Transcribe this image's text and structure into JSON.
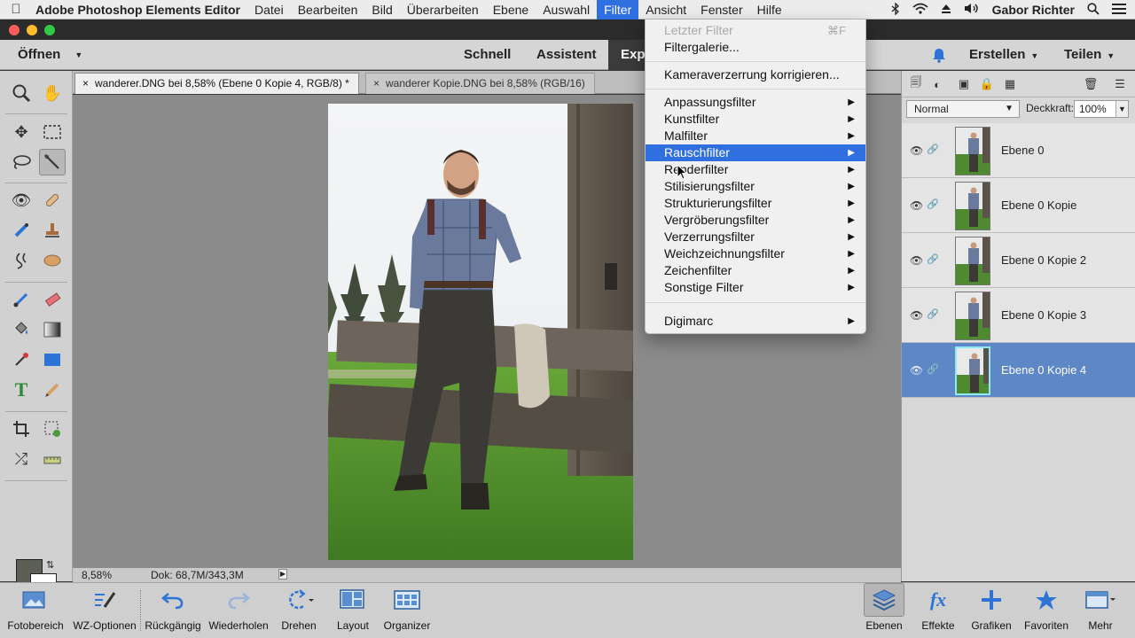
{
  "menubar": {
    "app_name": "Adobe Photoshop Elements Editor",
    "menus": [
      "Datei",
      "Bearbeiten",
      "Bild",
      "Überarbeiten",
      "Ebene",
      "Auswahl",
      "Filter",
      "Ansicht",
      "Fenster",
      "Hilfe"
    ],
    "active_menu": "Filter",
    "user": "Gabor Richter"
  },
  "modebar": {
    "open_label": "Öffnen",
    "tabs": [
      "Schnell",
      "Assistent",
      "Experte"
    ],
    "active_tab": "Experte",
    "create_label": "Erstellen",
    "share_label": "Teilen"
  },
  "doc_tabs": [
    {
      "title": "wanderer.DNG bei 8,58% (Ebene 0 Kopie 4, RGB/8) *",
      "active": true
    },
    {
      "title": "wanderer Kopie.DNG bei 8,58% (RGB/16)",
      "active": false
    }
  ],
  "status": {
    "zoom": "8,58%",
    "doc_info": "Dok: 68,7M/343,3M"
  },
  "layers_panel": {
    "blend_mode": "Normal",
    "opacity_label": "Deckkraft:",
    "opacity_value": "100%",
    "layers": [
      {
        "name": "Ebene 0",
        "selected": false
      },
      {
        "name": "Ebene 0 Kopie",
        "selected": false
      },
      {
        "name": "Ebene 0 Kopie 2",
        "selected": false
      },
      {
        "name": "Ebene 0 Kopie 3",
        "selected": false
      },
      {
        "name": "Ebene 0 Kopie 4",
        "selected": true
      }
    ]
  },
  "bottombar": {
    "items": [
      {
        "label": "Fotobereich",
        "icon": "photo-bin-icon"
      },
      {
        "label": "WZ-Optionen",
        "icon": "tool-options-icon"
      },
      {
        "label": "Rückgängig",
        "icon": "undo-icon"
      },
      {
        "label": "Wiederholen",
        "icon": "redo-icon"
      },
      {
        "label": "Drehen",
        "icon": "rotate-icon"
      },
      {
        "label": "Layout",
        "icon": "layout-icon"
      },
      {
        "label": "Organizer",
        "icon": "organizer-icon"
      },
      {
        "label": "Ebenen",
        "icon": "layers-icon"
      },
      {
        "label": "Effekte",
        "icon": "fx-icon"
      },
      {
        "label": "Grafiken",
        "icon": "plus-icon"
      },
      {
        "label": "Favoriten",
        "icon": "star-icon"
      },
      {
        "label": "Mehr",
        "icon": "more-icon"
      }
    ]
  },
  "filter_menu": {
    "items": [
      {
        "label": "Letzter Filter",
        "shortcut": "⌘F",
        "disabled": true
      },
      {
        "label": "Filtergalerie..."
      },
      {
        "label": "Kameraverzerrung korrigieren..."
      },
      {
        "label": "Anpassungsfilter",
        "submenu": true
      },
      {
        "label": "Kunstfilter",
        "submenu": true
      },
      {
        "label": "Malfilter",
        "submenu": true
      },
      {
        "label": "Rauschfilter",
        "submenu": true,
        "highlighted": true
      },
      {
        "label": "Renderfilter",
        "submenu": true
      },
      {
        "label": "Stilisierungsfilter",
        "submenu": true
      },
      {
        "label": "Strukturierungsfilter",
        "submenu": true
      },
      {
        "label": "Vergröberungsfilter",
        "submenu": true
      },
      {
        "label": "Verzerrungsfilter",
        "submenu": true
      },
      {
        "label": "Weichzeichnungsfilter",
        "submenu": true
      },
      {
        "label": "Zeichenfilter",
        "submenu": true
      },
      {
        "label": "Sonstige Filter",
        "submenu": true
      },
      {
        "label": "Digimarc",
        "submenu": true
      }
    ]
  },
  "colors": {
    "accent": "#2f6fe0",
    "layer_selected": "#5e87c6",
    "foreground_color": "#5b5f56",
    "background_color": "#ffffff"
  }
}
